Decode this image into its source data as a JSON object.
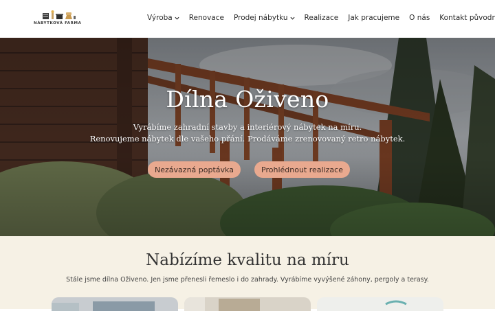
{
  "header": {
    "logo_icon": "furniture-icons",
    "logo_text": "NÁBYTKOVÁ FARMA",
    "nav": [
      {
        "label": "Výroba",
        "has_dropdown": true
      },
      {
        "label": "Renovace",
        "has_dropdown": false
      },
      {
        "label": "Prodej nábytku",
        "has_dropdown": true
      },
      {
        "label": "Realizace",
        "has_dropdown": false
      },
      {
        "label": "Jak pracujeme",
        "has_dropdown": false
      },
      {
        "label": "O nás",
        "has_dropdown": false
      },
      {
        "label": "Kontakt původní",
        "has_dropdown": false
      }
    ]
  },
  "hero": {
    "title": "Dílna Oživeno",
    "subtitle_line1": "Vyrábíme zahradní stavby a interiérový nábytek na míru.",
    "subtitle_line2": "Renovujeme nábytek dle vašeho přání. Prodáváme zrenovovaný retro nábytek.",
    "cta_primary": "Nezávazná poptávka",
    "cta_secondary": "Prohlédnout realizace"
  },
  "section": {
    "title": "Nabízíme kvalitu na míru",
    "text": "Stále jsme dílna Oživeno. Jen jsme přenesli řemeslo i do zahrady. Vyrábíme vyvýšené záhony, pergoly a terasy."
  },
  "colors": {
    "accent_button": "#e9a98f",
    "section_bg": "#f6f1e5",
    "nav_text": "#2b2b2b"
  }
}
